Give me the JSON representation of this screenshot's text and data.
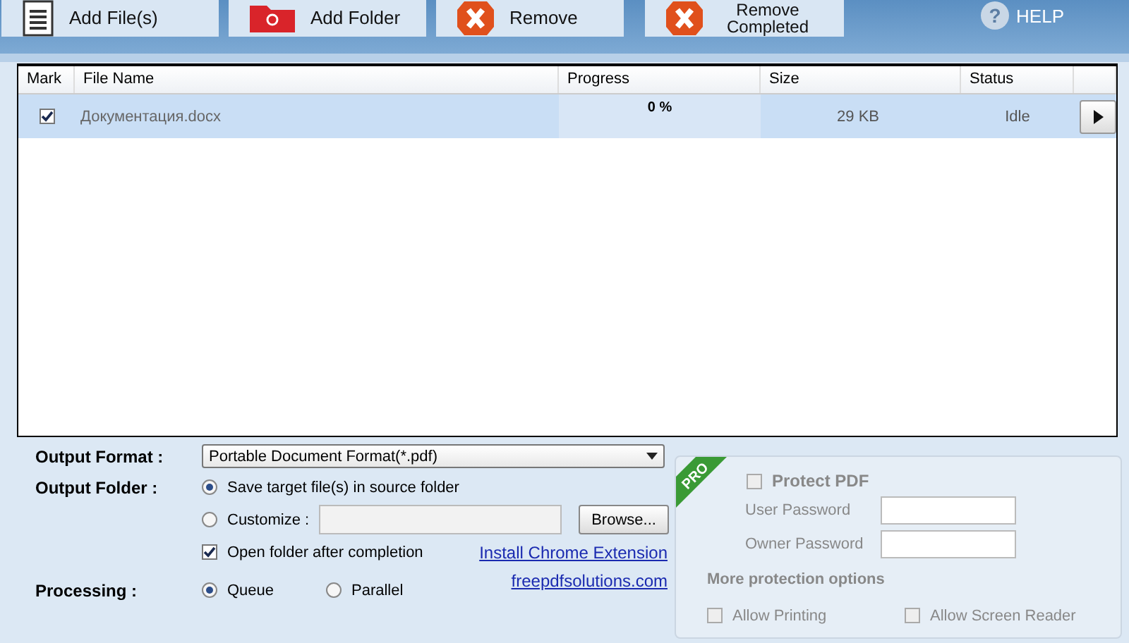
{
  "toolbar": {
    "buttons": [
      {
        "label": "Add File(s)",
        "kind": "add-files"
      },
      {
        "label": "Add Folder",
        "kind": "add-folder"
      },
      {
        "label": "Remove",
        "kind": "remove"
      },
      {
        "label": "Remove Completed",
        "kind": "remove"
      }
    ],
    "help_icon": "?",
    "help": "HELP"
  },
  "table": {
    "columns": [
      "Mark",
      "File Name",
      "Progress",
      "Size",
      "Status"
    ],
    "rows": [
      {
        "checked": true,
        "selected": true,
        "file_name": "Документация.docx",
        "progress": "0 %",
        "size": "29 KB",
        "status": "Idle"
      }
    ]
  },
  "output_format": {
    "label": "Output Format :",
    "value": "Portable Document Format(*.pdf)"
  },
  "output_folder": {
    "label": "Output Folder :",
    "options": [
      {
        "label": "Save target file(s) in source folder",
        "selected": true
      },
      {
        "label": "Customize :",
        "selected": false
      }
    ],
    "browse": "Browse...",
    "open_folder": {
      "label": "Open folder after completion",
      "checked": true
    }
  },
  "links": [
    "Install Chrome Extension",
    "freepdfsolutions.com"
  ],
  "processing": {
    "label": "Processing :",
    "options": [
      {
        "label": "Queue",
        "selected": true
      },
      {
        "label": "Parallel",
        "selected": false
      }
    ]
  },
  "protection": {
    "badge": "PRO",
    "disabled": true,
    "protect": {
      "label": "Protect PDF",
      "checked": false
    },
    "fields": [
      {
        "label": "User Password"
      },
      {
        "label": "Owner Password"
      }
    ],
    "more": "More protection options",
    "options": [
      {
        "label": "Allow Printing",
        "checked": false
      },
      {
        "label": "Allow Screen Reader",
        "checked": false
      }
    ]
  }
}
